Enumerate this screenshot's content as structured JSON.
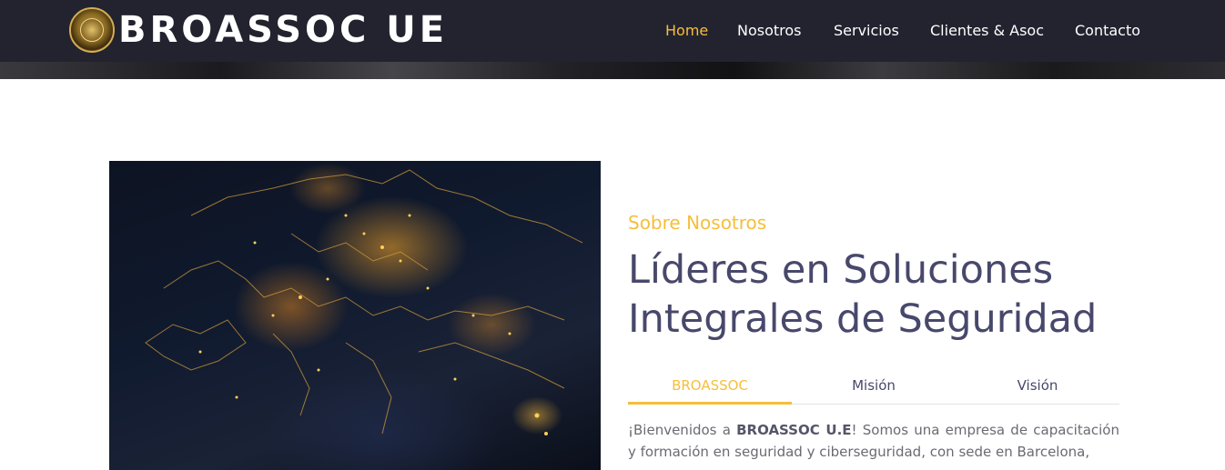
{
  "brand": {
    "name": "BROASSOC UE"
  },
  "nav": {
    "items": [
      {
        "label": "Home",
        "active": true
      },
      {
        "label": "Nosotros",
        "active": false
      },
      {
        "label": "Servicios",
        "active": false
      },
      {
        "label": "Clientes & Asoc",
        "active": false
      },
      {
        "label": "Contacto",
        "active": false
      }
    ]
  },
  "about": {
    "eyebrow": "Sobre Nosotros",
    "heading_line1": "Líderes en Soluciones",
    "heading_line2": "Integrales de Seguridad",
    "tabs": [
      {
        "label": "BROASSOC",
        "active": true
      },
      {
        "label": "Misión",
        "active": false
      },
      {
        "label": "Visión",
        "active": false
      }
    ],
    "paragraph": {
      "prefix": "¡Bienvenidos a ",
      "bold": "BROASSOC U.E",
      "suffix": "! Somos una empresa de capacitación y formación en seguridad y ciberseguridad, con sede en Barcelona,"
    }
  },
  "colors": {
    "accent": "#f6be3c",
    "navbar": "#23232f",
    "heading": "#47486b"
  }
}
